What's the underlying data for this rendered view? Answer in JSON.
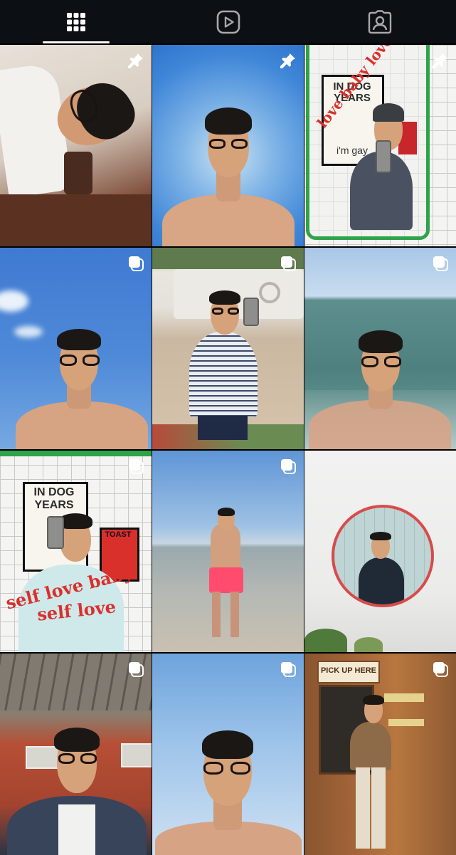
{
  "profile_tabs": [
    {
      "id": "posts",
      "icon": "grid-icon",
      "active": true
    },
    {
      "id": "reels",
      "icon": "reels-play-icon",
      "active": false
    },
    {
      "id": "tagged",
      "icon": "tagged-person-icon",
      "active": false
    }
  ],
  "colors": {
    "tabbar_bg": "#0c1014",
    "active_indicator": "#f5f5f5",
    "icon_active": "#ffffff",
    "icon_inactive": "#a8a8a8",
    "sign_red": "#d9302c",
    "mirror_green": "#2fa34a"
  },
  "posts": [
    {
      "id": 1,
      "badge": "pinned-icon",
      "scene": "selfie-tilted-indoor"
    },
    {
      "id": 2,
      "badge": "pinned-icon",
      "scene": "selfie-blue-sky"
    },
    {
      "id": 3,
      "badge": "pinned-icon",
      "scene": "mirror-selfie-tiled-wall",
      "wall_text": [
        "IN DOG",
        "YEARS",
        "i'm gay"
      ],
      "neon_text": "love baby love"
    },
    {
      "id": 4,
      "badge": "carousel-icon",
      "scene": "selfie-sky-clouds"
    },
    {
      "id": 5,
      "badge": "carousel-icon",
      "scene": "street-selfie-white-wall"
    },
    {
      "id": 6,
      "badge": "carousel-icon",
      "scene": "selfie-in-sea"
    },
    {
      "id": 7,
      "badge": "carousel-icon",
      "scene": "tiled-wall-selfie",
      "wall_text": [
        "IN DOG",
        "YEARS",
        "TOAST"
      ],
      "shirt_text": [
        "self love baby",
        "self love"
      ]
    },
    {
      "id": 8,
      "badge": "carousel-icon",
      "scene": "beach-walk-pink-shorts"
    },
    {
      "id": 9,
      "badge": "",
      "scene": "round-mirror-selfie"
    },
    {
      "id": 10,
      "badge": "carousel-icon",
      "scene": "restaurant-selfie"
    },
    {
      "id": 11,
      "badge": "carousel-icon",
      "scene": "selfie-pale-sky"
    },
    {
      "id": 12,
      "badge": "carousel-icon",
      "scene": "shop-standing",
      "sign_text": "PICK UP HERE"
    }
  ]
}
